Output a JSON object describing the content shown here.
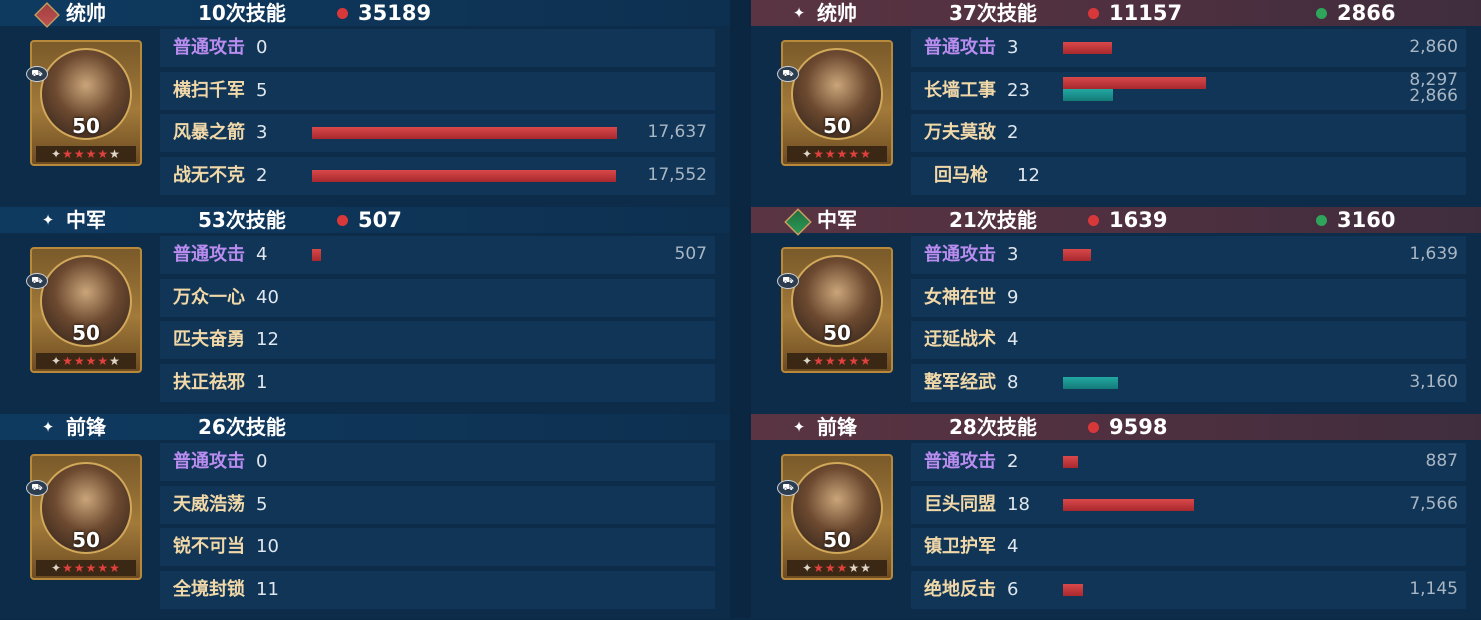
{
  "left": {
    "heroes": [
      {
        "position": "统帅",
        "skills_label": "10次技能",
        "damage": "35189",
        "heal": null,
        "level": "50",
        "stars": 4,
        "header_icon": "red-diamond-icon",
        "skills": [
          {
            "name": "普通攻击",
            "count": "0",
            "basic": true
          },
          {
            "name": "横扫千军",
            "count": "5"
          },
          {
            "name": "风暴之箭",
            "count": "3",
            "damage": 17637,
            "damage_label": "17,637"
          },
          {
            "name": "战无不克",
            "count": "2",
            "damage": 17552,
            "damage_label": "17,552"
          }
        ]
      },
      {
        "position": "中军",
        "skills_label": "53次技能",
        "damage": "507",
        "heal": null,
        "level": "50",
        "stars": 4,
        "header_icon": "sparkle-icon",
        "skills": [
          {
            "name": "普通攻击",
            "count": "4",
            "basic": true,
            "damage": 507,
            "damage_label": "507"
          },
          {
            "name": "万众一心",
            "count": "40"
          },
          {
            "name": "匹夫奋勇",
            "count": "12"
          },
          {
            "name": "扶正祛邪",
            "count": "1"
          }
        ]
      },
      {
        "position": "前锋",
        "skills_label": "26次技能",
        "damage": null,
        "heal": null,
        "level": "50",
        "stars": 5,
        "header_icon": "sparkle-icon",
        "skills": [
          {
            "name": "普通攻击",
            "count": "0",
            "basic": true
          },
          {
            "name": "天威浩荡",
            "count": "5"
          },
          {
            "name": "锐不可当",
            "count": "10"
          },
          {
            "name": "全境封锁",
            "count": "11"
          }
        ]
      }
    ]
  },
  "right": {
    "heroes": [
      {
        "position": "统帅",
        "skills_label": "37次技能",
        "damage": "11157",
        "heal": "2866",
        "level": "50",
        "stars": 5,
        "header_icon": "sparkle-icon",
        "skills": [
          {
            "name": "普通攻击",
            "count": "3",
            "basic": true,
            "damage": 2860,
            "damage_label": "2,860"
          },
          {
            "name": "长墙工事",
            "count": "23",
            "damage": 8297,
            "damage_label": "8,297",
            "heal": 2866,
            "heal_label": "2,866"
          },
          {
            "name": "万夫莫敌",
            "count": "2"
          },
          {
            "name": "回马枪",
            "count": "12"
          }
        ]
      },
      {
        "position": "中军",
        "skills_label": "21次技能",
        "damage": "1639",
        "heal": "3160",
        "level": "50",
        "stars": 5,
        "header_icon": "green-heart-icon",
        "skills": [
          {
            "name": "普通攻击",
            "count": "3",
            "basic": true,
            "damage": 1639,
            "damage_label": "1,639"
          },
          {
            "name": "女神在世",
            "count": "9"
          },
          {
            "name": "迂延战术",
            "count": "4"
          },
          {
            "name": "整军经武",
            "count": "8",
            "heal": 3160,
            "heal_label": "3,160"
          }
        ]
      },
      {
        "position": "前锋",
        "skills_label": "28次技能",
        "damage": "9598",
        "heal": null,
        "level": "50",
        "stars": 3,
        "header_icon": "sparkle-icon",
        "skills": [
          {
            "name": "普通攻击",
            "count": "2",
            "basic": true,
            "damage": 887,
            "damage_label": "887"
          },
          {
            "name": "巨头同盟",
            "count": "18",
            "damage": 7566,
            "damage_label": "7,566"
          },
          {
            "name": "镇卫护军",
            "count": "4"
          },
          {
            "name": "绝地反击",
            "count": "6",
            "damage": 1145,
            "damage_label": "1,145"
          }
        ]
      }
    ]
  },
  "colors": {
    "damage": "#d9383b",
    "heal": "#2fa45b",
    "basic_skill": "#b98cf0",
    "skill": "#f0d8a8"
  }
}
